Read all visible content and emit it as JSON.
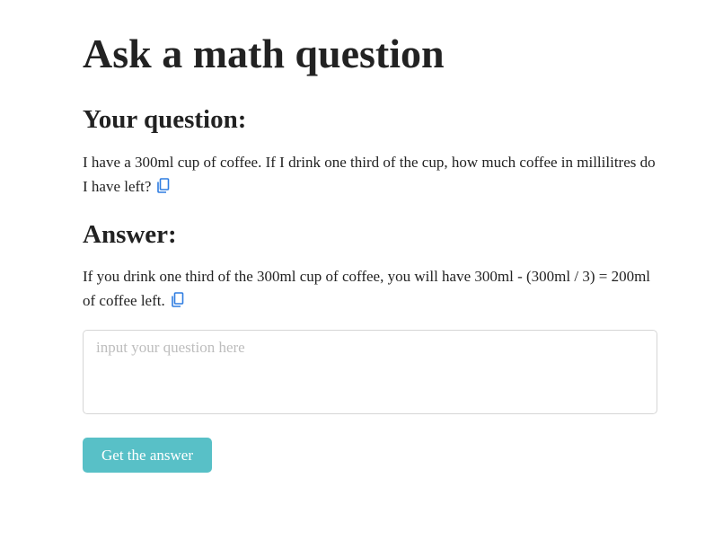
{
  "page": {
    "title": "Ask a math question"
  },
  "question": {
    "heading": "Your question:",
    "text": "I have a 300ml cup of coffee. If I drink one third of the cup, how much coffee in millilitres do I have left?",
    "copy_icon": "copy-icon"
  },
  "answer": {
    "heading": "Answer:",
    "text": "If you drink one third of the 300ml cup of coffee, you will have 300ml - (300ml / 3) = 200ml of coffee left.",
    "copy_icon": "copy-icon"
  },
  "input": {
    "value": "",
    "placeholder": "input your question here"
  },
  "submit": {
    "label": "Get the answer"
  },
  "colors": {
    "accent": "#58c0c7",
    "icon": "#2f7de1",
    "text": "#222222",
    "placeholder": "#bdbdbd",
    "border": "#d6d6d6"
  }
}
